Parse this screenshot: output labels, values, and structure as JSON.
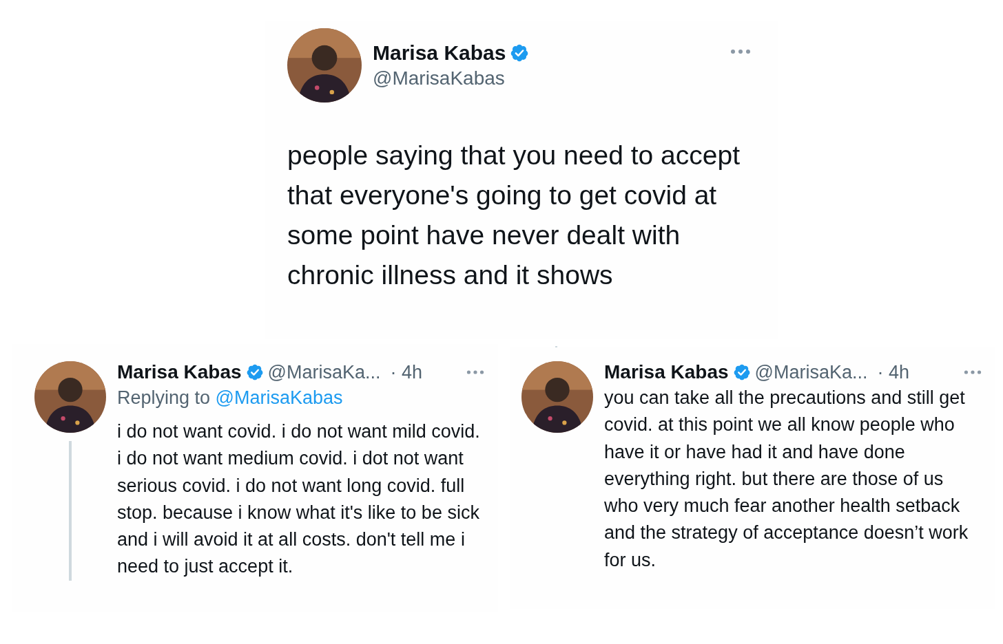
{
  "main_tweet": {
    "name": "Marisa Kabas",
    "verified": true,
    "handle": "@MarisaKabas",
    "text": "people saying that you need to accept that everyone's going to get covid at some point have never dealt with chronic illness and it shows"
  },
  "replies": [
    {
      "name": "Marisa Kabas",
      "verified": true,
      "handle": "@MarisaKa...",
      "time": "· 4h",
      "replying_label": "Replying to",
      "replying_handle": "@MarisaKabas",
      "text": "i do not want covid. i do not want mild covid. i do not want medium covid. i dot not want serious covid. i do not want long covid. full stop. because i know what it's like to be sick and i will avoid it at all costs. don't tell me i need to just accept it."
    },
    {
      "name": "Marisa Kabas",
      "verified": true,
      "handle": "@MarisaKa...",
      "time": "· 4h",
      "text": "you can take all the precautions and still get covid. at this point we all know people who have it or have had it and have done everything right. but there are those of us who very much fear another health setback and the strategy of acceptance doesn’t work for us."
    }
  ]
}
